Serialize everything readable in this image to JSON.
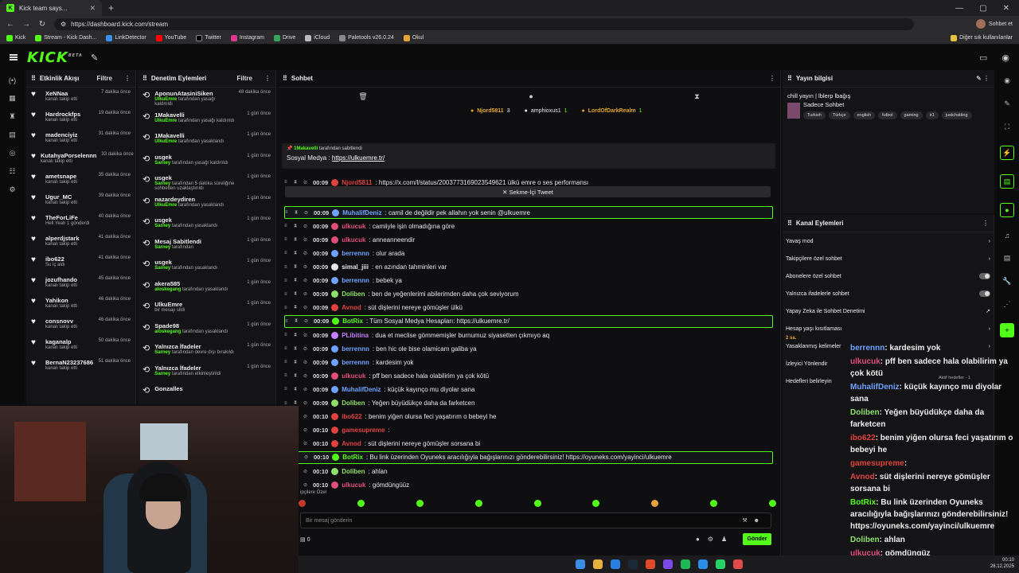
{
  "browser": {
    "tab_title": "Kick team says...",
    "url": "https://dashboard.kick.com/stream",
    "profile_label": "Sohbet et",
    "bookmarks": [
      "Kick",
      "Stream - Kick Dash...",
      "LinkDetector",
      "YouTube",
      "Twitter",
      "Instagram",
      "Drive",
      "iCloud",
      "Paletools v26.0.24",
      "Okul"
    ],
    "other_bookmarks": "Diğer sık kullanılanlar"
  },
  "header": {
    "logo": "KICK"
  },
  "activity": {
    "title": "Etkinlik Akışı",
    "filter": "Filtre",
    "items": [
      {
        "name": "XeNNaa",
        "sub": "kanalı takip etti",
        "time": "7 dakika önce"
      },
      {
        "name": "Hardrockfps",
        "sub": "kanalı takip etti",
        "time": "19 dakika önce"
      },
      {
        "name": "madenciyiz",
        "sub": "kanalı takip etti",
        "time": "31 dakika önce"
      },
      {
        "name": "KutahyaPorselennn",
        "sub": "kanalı takip etti",
        "time": "33 dakika önce"
      },
      {
        "name": "ametsnape",
        "sub": "kanalı takip etti",
        "time": "35 dakika önce"
      },
      {
        "name": "Ugur_MC",
        "sub": "kanalı takip etti",
        "time": "39 dakika önce"
      },
      {
        "name": "TheForLiFe",
        "sub": "Hell Yeah 1 gönderdi",
        "time": "40 dakika önce"
      },
      {
        "name": "alperdjstark",
        "sub": "kanalı takip etti",
        "time": "41 dakika önce"
      },
      {
        "name": "ibo622",
        "sub": "Su iç aldı",
        "time": "41 dakika önce"
      },
      {
        "name": "jozufhando",
        "sub": "kanalı takip etti",
        "time": "45 dakika önce"
      },
      {
        "name": "Yahikon",
        "sub": "kanalı takip etti",
        "time": "46 dakika önce"
      },
      {
        "name": "consnovv",
        "sub": "kanalı takip etti",
        "time": "46 dakika önce"
      },
      {
        "name": "kaganalp",
        "sub": "kanalı takip etti",
        "time": "50 dakika önce"
      },
      {
        "name": "BernaN23237686",
        "sub": "kanalı takip etti",
        "time": "51 dakika önce"
      }
    ]
  },
  "modlog": {
    "title": "Denetim Eylemleri",
    "filter": "Filtre",
    "items": [
      {
        "name": "AponunAtasiniSiken",
        "by": "UlkuEmre",
        "sub": "tarafından yasağı kaldırıldı",
        "time": "48 dakika önce"
      },
      {
        "name": "1Makavelli",
        "by": "UlkuEmre",
        "sub": "tarafından yasağı kaldırıldı",
        "time": "1 gün önce"
      },
      {
        "name": "1Makavelli",
        "by": "UlkuEmre",
        "sub": "tarafından yasaklandı",
        "time": "1 gün önce"
      },
      {
        "name": "usgek",
        "by": "Sarney",
        "sub": "tarafından yasağı kaldırıldı",
        "time": "1 gün önce"
      },
      {
        "name": "usgek",
        "by": "Sarney",
        "sub": "tarafından 5 dakika süreliğine sohbetten uzaklaştırıldı",
        "time": "1 gün önce"
      },
      {
        "name": "nazardeydiren",
        "by": "UlkuEmre",
        "sub": "tarafından yasaklandı",
        "time": "1 gün önce"
      },
      {
        "name": "usgek",
        "by": "Sarney",
        "sub": "tarafından yasaklandı",
        "time": "1 gün önce"
      },
      {
        "name": "Mesaj Sabitlendi",
        "by": "Sarney",
        "sub": "tarafından",
        "time": "1 gün önce"
      },
      {
        "name": "usgek",
        "by": "Sarney",
        "sub": "tarafından yasaklandı",
        "time": "1 gün önce"
      },
      {
        "name": "akera585",
        "by": "aloskegang",
        "sub": "tarafından yasaklandı",
        "time": "1 gün önce"
      },
      {
        "name": "UlkuEmre",
        "by": "",
        "sub": "bir mesajı sildi",
        "time": "1 gün önce"
      },
      {
        "name": "Spade98",
        "by": "aloskegang",
        "sub": "tarafından yasaklandı",
        "time": "1 gün önce"
      },
      {
        "name": "Yalnızca İfadeler",
        "by": "Sarney",
        "sub": "tarafından devre dışı bırakıldı",
        "time": "1 gün önce"
      },
      {
        "name": "Yalnızca İfadeler",
        "by": "Sarney",
        "sub": "tarafından etkinleştirildi",
        "time": "1 gün önce"
      },
      {
        "name": "Gonzalles",
        "by": "",
        "sub": "",
        "time": ""
      }
    ]
  },
  "chat": {
    "title": "Sohbet",
    "top_gifters": [
      {
        "name": "Njord5811",
        "count": "3"
      },
      {
        "name": "amphioxus1",
        "count": "1"
      },
      {
        "name": "LordOfDarkRealm",
        "count": "1"
      }
    ],
    "pinned_by": "1Makavelli",
    "pinned_by_suffix": "tarafından sabitlendi",
    "pinned_text": "Sosyal Medya : ",
    "pinned_link": "https://ulkuemre.tr/",
    "tweet_button": "Sekme-İçi Tweet",
    "messages": [
      {
        "time": "00:09",
        "user": "Njord5811",
        "color": "#e0423f",
        "text": ": https://x.com/l/status/2003773169023549621 ülkü emre o ses performansı",
        "hl": false
      },
      {
        "time": "00:09",
        "user": "MuhalifDeniz",
        "color": "#6fa3ff",
        "text": ": camil de değildir pek allahın yok senin @ulkuemre",
        "hl": true
      },
      {
        "time": "00:09",
        "user": "ulkucuk",
        "color": "#e04f7a",
        "text": ": camiiyle işin olmadığına göre",
        "hl": false
      },
      {
        "time": "00:09",
        "user": "ulkucuk",
        "color": "#e04f7a",
        "text": ": anneanneendir",
        "hl": false
      },
      {
        "time": "00:09",
        "user": "berrennn",
        "color": "#6fa3ff",
        "text": ": olur arada",
        "hl": false
      },
      {
        "time": "00:09",
        "user": "simal_jiii",
        "color": "#e6e6e6",
        "text": ": en azından tahminleri var",
        "hl": false
      },
      {
        "time": "00:09",
        "user": "berrennn",
        "color": "#6fa3ff",
        "text": ": bebek ya",
        "hl": false
      },
      {
        "time": "00:09",
        "user": "Doliben",
        "color": "#8ee06a",
        "text": ": ben de yeğenlerimi abilerimden daha çok seviyorum",
        "hl": false
      },
      {
        "time": "00:09",
        "user": "Avnod",
        "color": "#e0423f",
        "text": ": süt dişlerini nereye gömüşler ülkü",
        "hl": false
      },
      {
        "time": "00:09",
        "user": "BotRix",
        "color": "#53fc18",
        "text": ": Tüm Sosyal Medya Hesapları: https://ulkuemre.tr/",
        "hl": true
      },
      {
        "time": "00:09",
        "user": "PLibitina",
        "color": "#c77dff",
        "text": ": dua et meclise gömmemişler burnumuz siyasetten çıkmıyo aq",
        "hl": false
      },
      {
        "time": "00:09",
        "user": "berrennn",
        "color": "#6fa3ff",
        "text": ": ben hic ole bise olamicam galiba ya",
        "hl": false
      },
      {
        "time": "00:09",
        "user": "berrennn",
        "color": "#6fa3ff",
        "text": ": kardesim yok",
        "hl": false
      },
      {
        "time": "00:09",
        "user": "ulkucuk",
        "color": "#e04f7a",
        "text": ": pff ben sadece hala olabilirim ya çok kötü",
        "hl": false
      },
      {
        "time": "00:09",
        "user": "MuhalifDeniz",
        "color": "#6fa3ff",
        "text": ": küçük kayınço mu diyolar sana",
        "hl": false
      },
      {
        "time": "00:09",
        "user": "Doliben",
        "color": "#8ee06a",
        "text": ": Yeğen büyüdükçe daha da farketcen",
        "hl": false
      },
      {
        "time": "00:10",
        "user": "ibo622",
        "color": "#e0423f",
        "text": ": benim yiğen olursa feci yaşatırım o bebeyi he",
        "hl": false
      },
      {
        "time": "00:10",
        "user": "gamesupreme",
        "color": "#e0423f",
        "text": ":",
        "hl": false
      },
      {
        "time": "00:10",
        "user": "Avnod",
        "color": "#e0423f",
        "text": ": süt dişlerini nereye gömüşler sorsana bi",
        "hl": false
      },
      {
        "time": "00:10",
        "user": "BotRix",
        "color": "#53fc18",
        "text": ": Bu link üzerinden Oyuneks aracılığıyla bağışlarınızı gönderebilirsiniz! https://oyuneks.com/yayinci/ulkuemre",
        "hl": true
      },
      {
        "time": "00:10",
        "user": "Doliben",
        "color": "#8ee06a",
        "text": ": ahlan",
        "hl": false
      },
      {
        "time": "00:10",
        "user": "ulkucuk",
        "color": "#e04f7a",
        "text": ": gömdüngüüz",
        "hl": false
      }
    ],
    "followers_only_label": "ipçilere Özel",
    "input_placeholder": "Bir mesaj gönderin",
    "viewer_count": "0",
    "send_label": "Gönder"
  },
  "stream_info": {
    "title": "Yayın bilgisi",
    "stream_title": "chill yayın | lblerp lbağış",
    "category": "Sadece Sohbet",
    "tags": [
      "Turkish",
      "Türkçe",
      "english",
      "futbol",
      "gaming",
      "ir1",
      "justchatting"
    ]
  },
  "channel_actions": {
    "title": "Kanal Eylemleri",
    "rows": [
      {
        "label": "Yavaş mod",
        "kind": "chev"
      },
      {
        "label": "Takipçilere özel sohbet",
        "kind": "chev"
      },
      {
        "label": "Abonelere özel sohbet",
        "kind": "toggle"
      },
      {
        "label": "Yalnızca ifadelerle sohbet",
        "kind": "toggle"
      },
      {
        "label": "Yapay Zeka ile Sohbet Denetimi",
        "kind": "ext"
      },
      {
        "label": "Hesap yaşı kısıtlaması",
        "kind": "chev"
      },
      {
        "label": "Yasaklanmış kelimeler",
        "kind": "chev"
      },
      {
        "label": "İzleyici Yönlendir",
        "kind": "none"
      },
      {
        "label": "Hedefleri belirleyin",
        "kind": "none"
      }
    ],
    "age_value": "2 sa.",
    "active_filters": "Aktif hedefler - 1"
  },
  "overlay_chat": [
    {
      "user": "berrennn",
      "text": ": kardesim yok",
      "color": "#6fa3ff"
    },
    {
      "user": "ulkucuk",
      "text": ": pff ben sadece hala olabilirim ya çok kötü",
      "color": "#e04f7a"
    },
    {
      "user": "MuhalifDeniz",
      "text": ": küçük kayınço mu diyolar sana",
      "color": "#6fa3ff"
    },
    {
      "user": "Doliben",
      "text": ": Yeğen büyüdükçe daha da farketcen",
      "color": "#8ee06a"
    },
    {
      "user": "ibo622",
      "text": ": benim yiğen olursa feci yaşatırım o bebeyi he",
      "color": "#e0423f"
    },
    {
      "user": "gamesupreme",
      "text": ":",
      "color": "#e0423f"
    },
    {
      "user": "Avnod",
      "text": ": süt dişlerini nereye gömüşler sorsana bi",
      "color": "#e0423f"
    },
    {
      "user": "BotRix",
      "text": ": Bu link üzerinden Oyuneks aracılığıyla bağışlarınızı gönderebilirsiniz! https://oyuneks.com/yayinci/ulkuemre",
      "color": "#53fc18"
    },
    {
      "user": "Doliben",
      "text": ": ahlan",
      "color": "#8ee06a"
    },
    {
      "user": "ulkucuk",
      "text": ": gömdüngüz",
      "color": "#e04f7a"
    }
  ],
  "taskbar": {
    "time": "00:10",
    "date": "28.12.2025"
  }
}
